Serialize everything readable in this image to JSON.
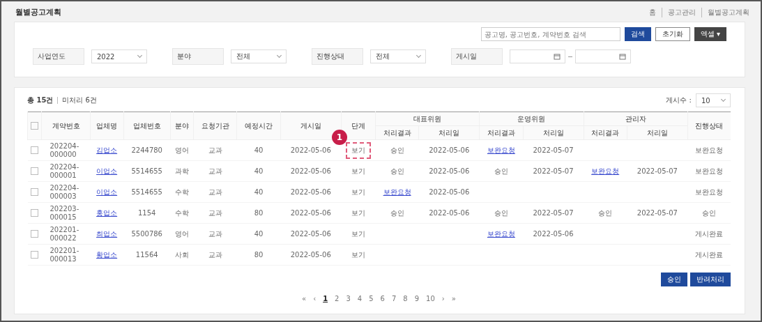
{
  "page_title": "월별공고계획",
  "breadcrumb": [
    "홈",
    "공고관리",
    "월별공고계획"
  ],
  "search": {
    "placeholder": "공고명, 공고번호, 계약번호 검색"
  },
  "top_buttons": [
    {
      "label": "검색",
      "kind": "primary"
    },
    {
      "label": "초기화",
      "kind": "outline"
    },
    {
      "label": "엑셀 ▾",
      "kind": "dark"
    }
  ],
  "filters": [
    {
      "label": "사업연도",
      "value": "2022",
      "kind": "select"
    },
    {
      "label": "분야",
      "value": "전체",
      "kind": "select"
    },
    {
      "label": "진행상태",
      "value": "전체",
      "kind": "select"
    },
    {
      "label": "게시일",
      "kind": "daterange"
    }
  ],
  "summary": {
    "total": "총 15건",
    "pending": "미처리 6건"
  },
  "page_size": {
    "label": "게시수 :",
    "value": "10"
  },
  "all_checked": false,
  "columns": [
    "계약번호",
    "업체명",
    "업체번호",
    "분야",
    "요청기관",
    "예정시간",
    "게시일",
    "단계"
  ],
  "groups": [
    {
      "label": "대표위원",
      "sub": [
        "처리결과",
        "처리일"
      ]
    },
    {
      "label": "운영위원",
      "sub": [
        "처리결과",
        "처리일"
      ]
    },
    {
      "label": "관리자",
      "sub": [
        "처리결과",
        "처리일"
      ]
    }
  ],
  "last_column": "진행상태",
  "rows": [
    {
      "checked": false,
      "marked": true,
      "cells": [
        "202204-000000",
        "김업소",
        "2244780",
        "영어",
        "교과",
        "40",
        "2022-05-06",
        "보기"
      ],
      "rep": {
        "result": {
          "text": "승인",
          "link": false
        },
        "date": "2022-05-06"
      },
      "op": {
        "result": {
          "text": "보완요청",
          "link": true
        },
        "date": "2022-05-07"
      },
      "status": "보완요청"
    },
    {
      "checked": false,
      "marked": false,
      "cells": [
        "202204-000001",
        "이업소",
        "5514655",
        "과학",
        "교과",
        "40",
        "2022-05-06",
        "보기"
      ],
      "rep": {
        "result": {
          "text": "승인",
          "link": false
        },
        "date": "2022-05-06"
      },
      "op": {
        "result": {
          "text": "승인",
          "link": false
        },
        "date": "2022-05-07"
      },
      "admin": {
        "result": {
          "text": "보완요청",
          "link": true
        },
        "date": "2022-05-07"
      },
      "status": "보완요청"
    },
    {
      "checked": false,
      "marked": false,
      "cells": [
        "202204-000003",
        "이업소",
        "5514655",
        "수학",
        "교과",
        "40",
        "2022-05-06",
        "보기"
      ],
      "rep": {
        "result": {
          "text": "보완요청",
          "link": true
        },
        "date": "2022-05-06"
      },
      "status": "보완요청"
    },
    {
      "checked": false,
      "marked": false,
      "cells": [
        "202203-000015",
        "홍업소",
        "1154",
        "수학",
        "교과",
        "80",
        "2022-05-06",
        "보기"
      ],
      "rep": {
        "result": {
          "text": "승인",
          "link": false
        },
        "date": "2022-05-06"
      },
      "op": {
        "result": {
          "text": "승인",
          "link": false
        },
        "date": "2022-05-07"
      },
      "admin": {
        "result": {
          "text": "승인",
          "link": false
        },
        "date": "2022-05-07"
      },
      "status": "승인"
    },
    {
      "checked": false,
      "marked": false,
      "cells": [
        "202201-000022",
        "최업소",
        "5500786",
        "영어",
        "교과",
        "40",
        "2022-05-06",
        "보기"
      ],
      "op": {
        "result": {
          "text": "보완요청",
          "link": true
        },
        "date": "2022-05-06"
      },
      "status": "게시완료"
    },
    {
      "checked": false,
      "marked": false,
      "cells": [
        "202201-000013",
        "황업소",
        "11564",
        "사회",
        "교과",
        "80",
        "2022-05-06",
        "보기"
      ],
      "status": "게시완료"
    }
  ],
  "marker": "1",
  "bottom_buttons": [
    {
      "label": "승인"
    },
    {
      "label": "반려처리"
    }
  ],
  "pagination": [
    {
      "label": "«",
      "selected": false
    },
    {
      "label": "‹",
      "selected": false
    },
    {
      "label": "1",
      "selected": true
    },
    {
      "label": "2",
      "selected": false
    },
    {
      "label": "3",
      "selected": false
    },
    {
      "label": "4",
      "selected": false
    },
    {
      "label": "5",
      "selected": false
    },
    {
      "label": "6",
      "selected": false
    },
    {
      "label": "7",
      "selected": false
    },
    {
      "label": "8",
      "selected": false
    },
    {
      "label": "9",
      "selected": false
    },
    {
      "label": "10",
      "selected": false
    },
    {
      "label": "›",
      "selected": false
    },
    {
      "label": "»",
      "selected": false
    }
  ]
}
